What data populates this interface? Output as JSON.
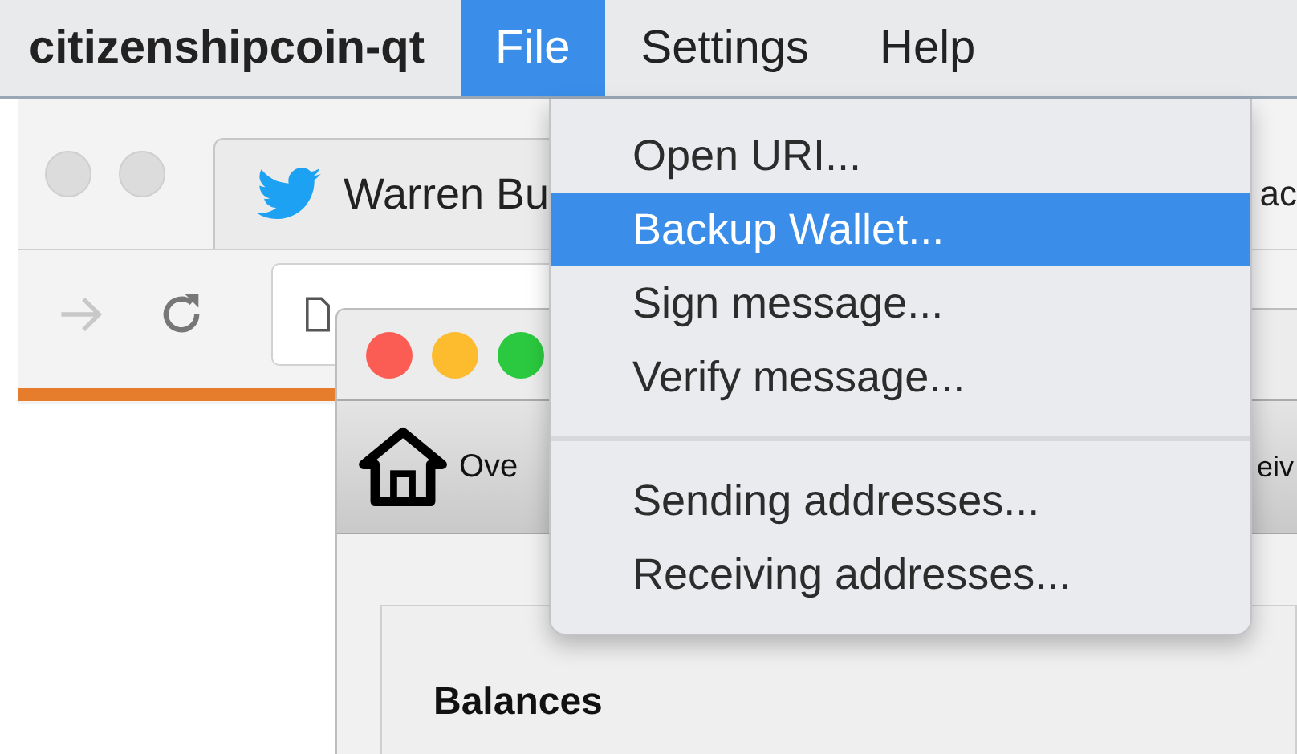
{
  "menubar": {
    "app_name": "citizenshipcoin-qt",
    "menus": [
      {
        "label": "File",
        "selected": true
      },
      {
        "label": "Settings",
        "selected": false
      },
      {
        "label": "Help",
        "selected": false
      }
    ]
  },
  "browser": {
    "tabs": [
      {
        "title": "Warren Bu"
      },
      {
        "title": "ac"
      }
    ],
    "progress": {
      "level": 0.25
    }
  },
  "wallet": {
    "toolbar": [
      {
        "label": "Ove"
      },
      {
        "label": "eiv"
      }
    ],
    "section_title": "Balances"
  },
  "file_menu": {
    "groups": [
      [
        {
          "label": "Open URI...",
          "selected": false
        },
        {
          "label": "Backup Wallet...",
          "selected": true
        },
        {
          "label": "Sign message...",
          "selected": false
        },
        {
          "label": "Verify message...",
          "selected": false
        }
      ],
      [
        {
          "label": "Sending addresses...",
          "selected": false
        },
        {
          "label": "Receiving addresses...",
          "selected": false
        }
      ]
    ]
  }
}
